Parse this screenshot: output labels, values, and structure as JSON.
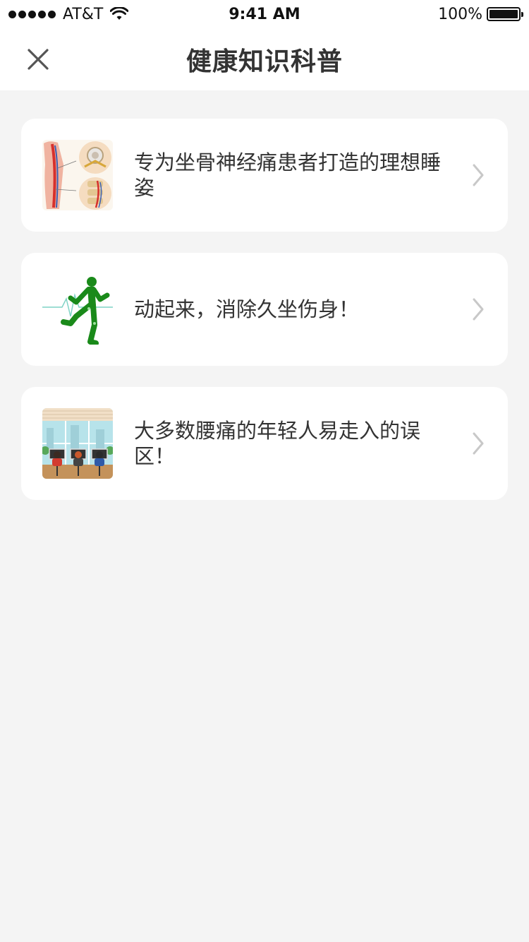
{
  "status_bar": {
    "carrier": "AT&T",
    "time": "9:41 AM",
    "battery": "100%"
  },
  "nav": {
    "title": "健康知识科普",
    "close_icon": "close-icon"
  },
  "articles": [
    {
      "title": "专为坐骨神经痛患者打造的理想睡姿",
      "thumbnail": "spine-anatomy-illustration"
    },
    {
      "title": "动起来，消除久坐伤身！",
      "thumbnail": "running-man-heartbeat-illustration"
    },
    {
      "title": "大多数腰痛的年轻人易走入的误区！",
      "thumbnail": "office-workers-illustration"
    }
  ],
  "colors": {
    "background": "#f4f4f4",
    "card": "#ffffff",
    "text": "#333333",
    "chevron": "#c8c8c8",
    "runner_green": "#1a8a1a"
  }
}
